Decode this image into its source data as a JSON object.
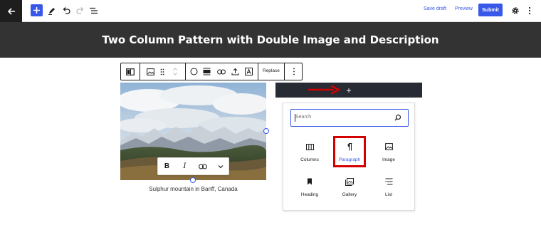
{
  "header": {
    "save_draft": "Save draft",
    "preview": "Preview",
    "submit": "Submit",
    "icons": [
      "wordpress-back-icon",
      "plus-icon",
      "pencil-icon",
      "undo-icon",
      "redo-icon",
      "list-view-icon",
      "gear-icon",
      "kebab-menu-icon"
    ]
  },
  "hero": {
    "title": "Two Column Pattern with Double Image and Description"
  },
  "block_toolbar": {
    "replace": "Replace"
  },
  "image": {
    "caption": "Sulphur mountain in Banff, Canada"
  },
  "format_toolbar": {
    "bold": "B",
    "italic": "I"
  },
  "appender": {
    "label": "+"
  },
  "inserter": {
    "search_placeholder": "Search",
    "blocks": [
      {
        "label": "Columns",
        "icon": "columns-icon"
      },
      {
        "label": "Paragraph",
        "icon": "pilcrow-icon"
      },
      {
        "label": "Image",
        "icon": "image-icon"
      },
      {
        "label": "Heading",
        "icon": "bookmark-icon"
      },
      {
        "label": "Gallery",
        "icon": "gallery-icon"
      },
      {
        "label": "List",
        "icon": "list-icon"
      }
    ]
  },
  "colors": {
    "accent": "#3858e9",
    "hero_bg": "#333333",
    "appender_bg": "#262b34",
    "annotation_red": "#d40000"
  }
}
